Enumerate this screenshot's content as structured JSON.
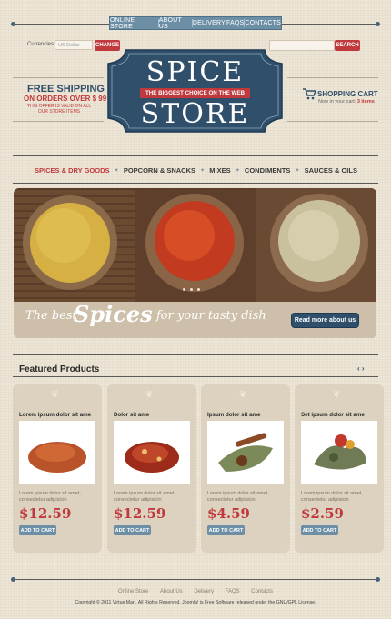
{
  "top_nav": [
    "Online Store",
    "About Us",
    "Delivery",
    "FAQs",
    "Contacts"
  ],
  "currency": {
    "label": "Currencies:",
    "selected": "US Dollar",
    "change_button": "CHANGE"
  },
  "search": {
    "placeholder": "",
    "button": "SEARCH"
  },
  "logo": {
    "line1": "SPICE",
    "tagline": "THE BIGGEST CHOICE ON THE WEB",
    "line2": "STORE"
  },
  "shipping": {
    "title": "FREE SHIPPING",
    "subtitle": "ON ORDERS OVER $ 99",
    "note": "THIS OFFER IS VALID ON ALL OUR STORE ITEMS"
  },
  "cart": {
    "label": "SHOPPING CART",
    "status_prefix": "Now in your cart",
    "status_count": "3 items"
  },
  "main_menu": [
    "SPICES & DRY GOODS",
    "POPCORN & SNACKS",
    "MIXES",
    "CONDIMENTS",
    "SAUCES & OILS"
  ],
  "banner": {
    "text_best": "The best",
    "text_spices": "Spices",
    "text_rest": "for your tasty dish",
    "button": "Read more about us"
  },
  "featured": {
    "title": "Featured Products",
    "arrows": "‹ ›",
    "products": [
      {
        "name": "Lorem ipsum dolor sit ame",
        "desc": "Lorem ipsum dolor sit amet, consectetur adipisicin",
        "price": "$12.59",
        "button": "ADD TO CART"
      },
      {
        "name": "Dolor sit ame",
        "desc": "Lorem ipsum dolor sit amet, consectetur adipisicin",
        "price": "$12.59",
        "button": "ADD TO CART"
      },
      {
        "name": "Ipsum dolor sit ame",
        "desc": "Lorem ipsum dolor sit amet, consectetur adipisicin",
        "price": "$4.59",
        "button": "ADD TO CART"
      },
      {
        "name": "Set ipsum dolor sit ame",
        "desc": "Lorem ipsum dolor sit amet, consectetur adipisicin",
        "price": "$2.59",
        "button": "ADD TO CART"
      }
    ]
  },
  "footer": {
    "nav": [
      "Online Store",
      "About Us",
      "Delivery",
      "FAQS",
      "Contacts"
    ],
    "copyright": "Copyright © 2011 Virtue Mart. All Rights Reserved. Joomla! is Free Software released under the GNU/GPL License."
  },
  "colors": {
    "accent_red": "#c0393c",
    "navy": "#2f4f6a",
    "steel_blue": "#6d8fa6",
    "paper": "#ede5d6"
  }
}
